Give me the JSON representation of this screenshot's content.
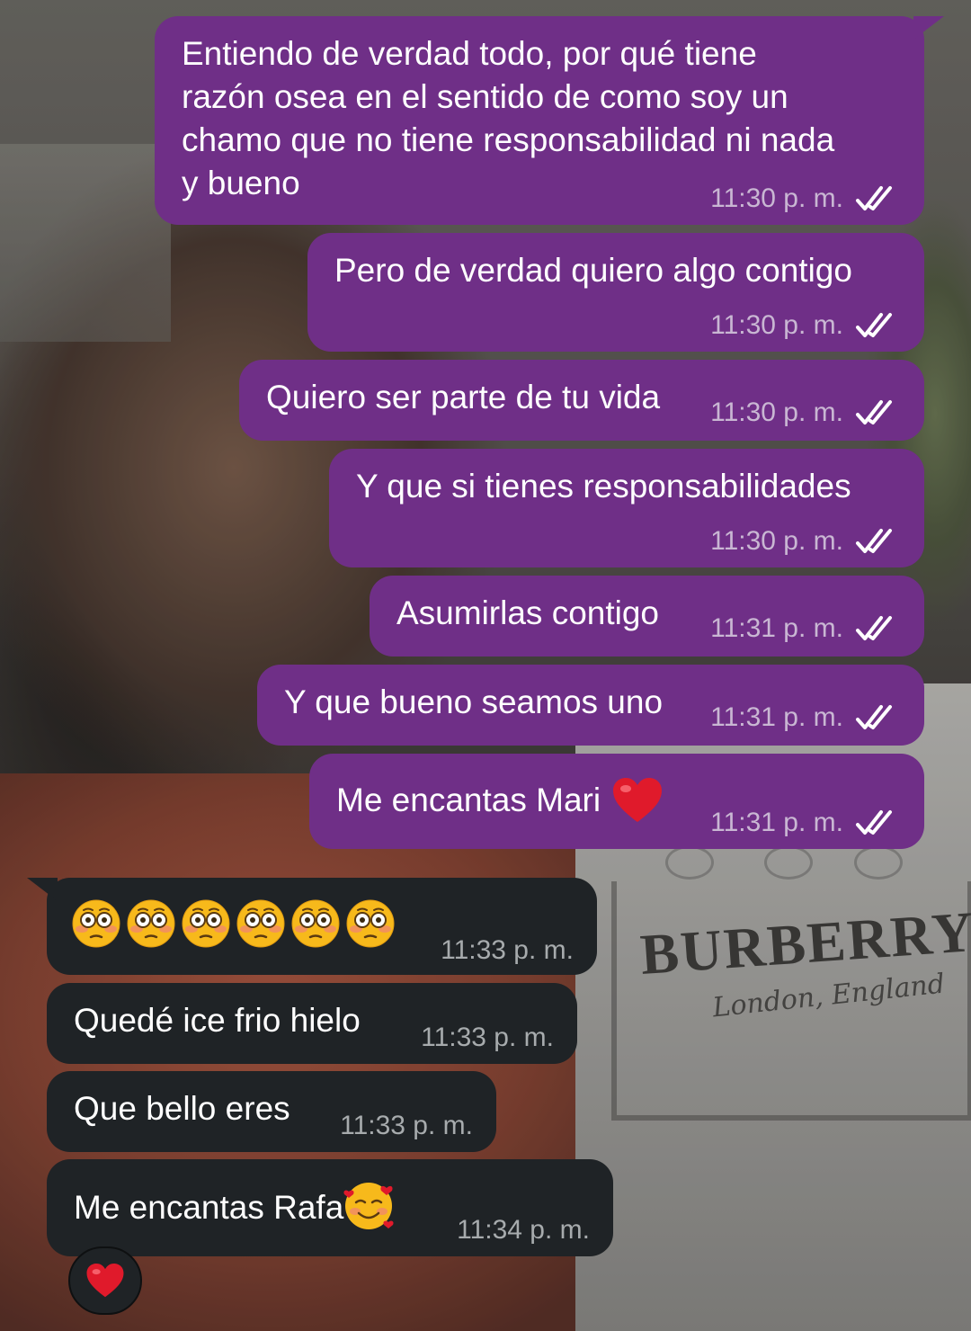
{
  "chat": {
    "outgoing": [
      {
        "text": "Entiendo de verdad todo, por qué tiene\nrazón osea en el sentido de como soy un\nchamo que no tiene responsabilidad ni nada\ny bueno",
        "time": "11:30 p. m."
      },
      {
        "text": "Pero de verdad quiero algo contigo",
        "time": "11:30 p. m."
      },
      {
        "text": "Quiero ser parte de tu vida",
        "time": "11:30 p. m."
      },
      {
        "text": "Y que si tienes responsabilidades",
        "time": "11:30 p. m."
      },
      {
        "text": "Asumirlas contigo",
        "time": "11:31 p. m."
      },
      {
        "text": "Y que bueno seamos uno",
        "time": "11:31 p. m."
      },
      {
        "text": "Me encantas Mari",
        "emoji": "red-heart",
        "time": "11:31 p. m."
      }
    ],
    "incoming": [
      {
        "emoji": "flushed-face",
        "emoji_count": 6,
        "time": "11:33 p. m."
      },
      {
        "text": "Quedé ice frio hielo",
        "time": "11:33 p. m."
      },
      {
        "text": "Que bello eres",
        "time": "11:33 p. m."
      },
      {
        "text": "Me encantas Rafa",
        "emoji": "smiling-face-with-hearts",
        "time": "11:34 p. m."
      }
    ],
    "reaction": {
      "emoji": "red-heart"
    },
    "read_status_icon": "double-check-icon"
  },
  "wallpaper": {
    "brand": "BURBERRY",
    "brand_sub": "London, England"
  },
  "colors": {
    "outgoing_bubble": "#6f2f87",
    "incoming_bubble": "#1f2326",
    "text": "#ffffff"
  }
}
